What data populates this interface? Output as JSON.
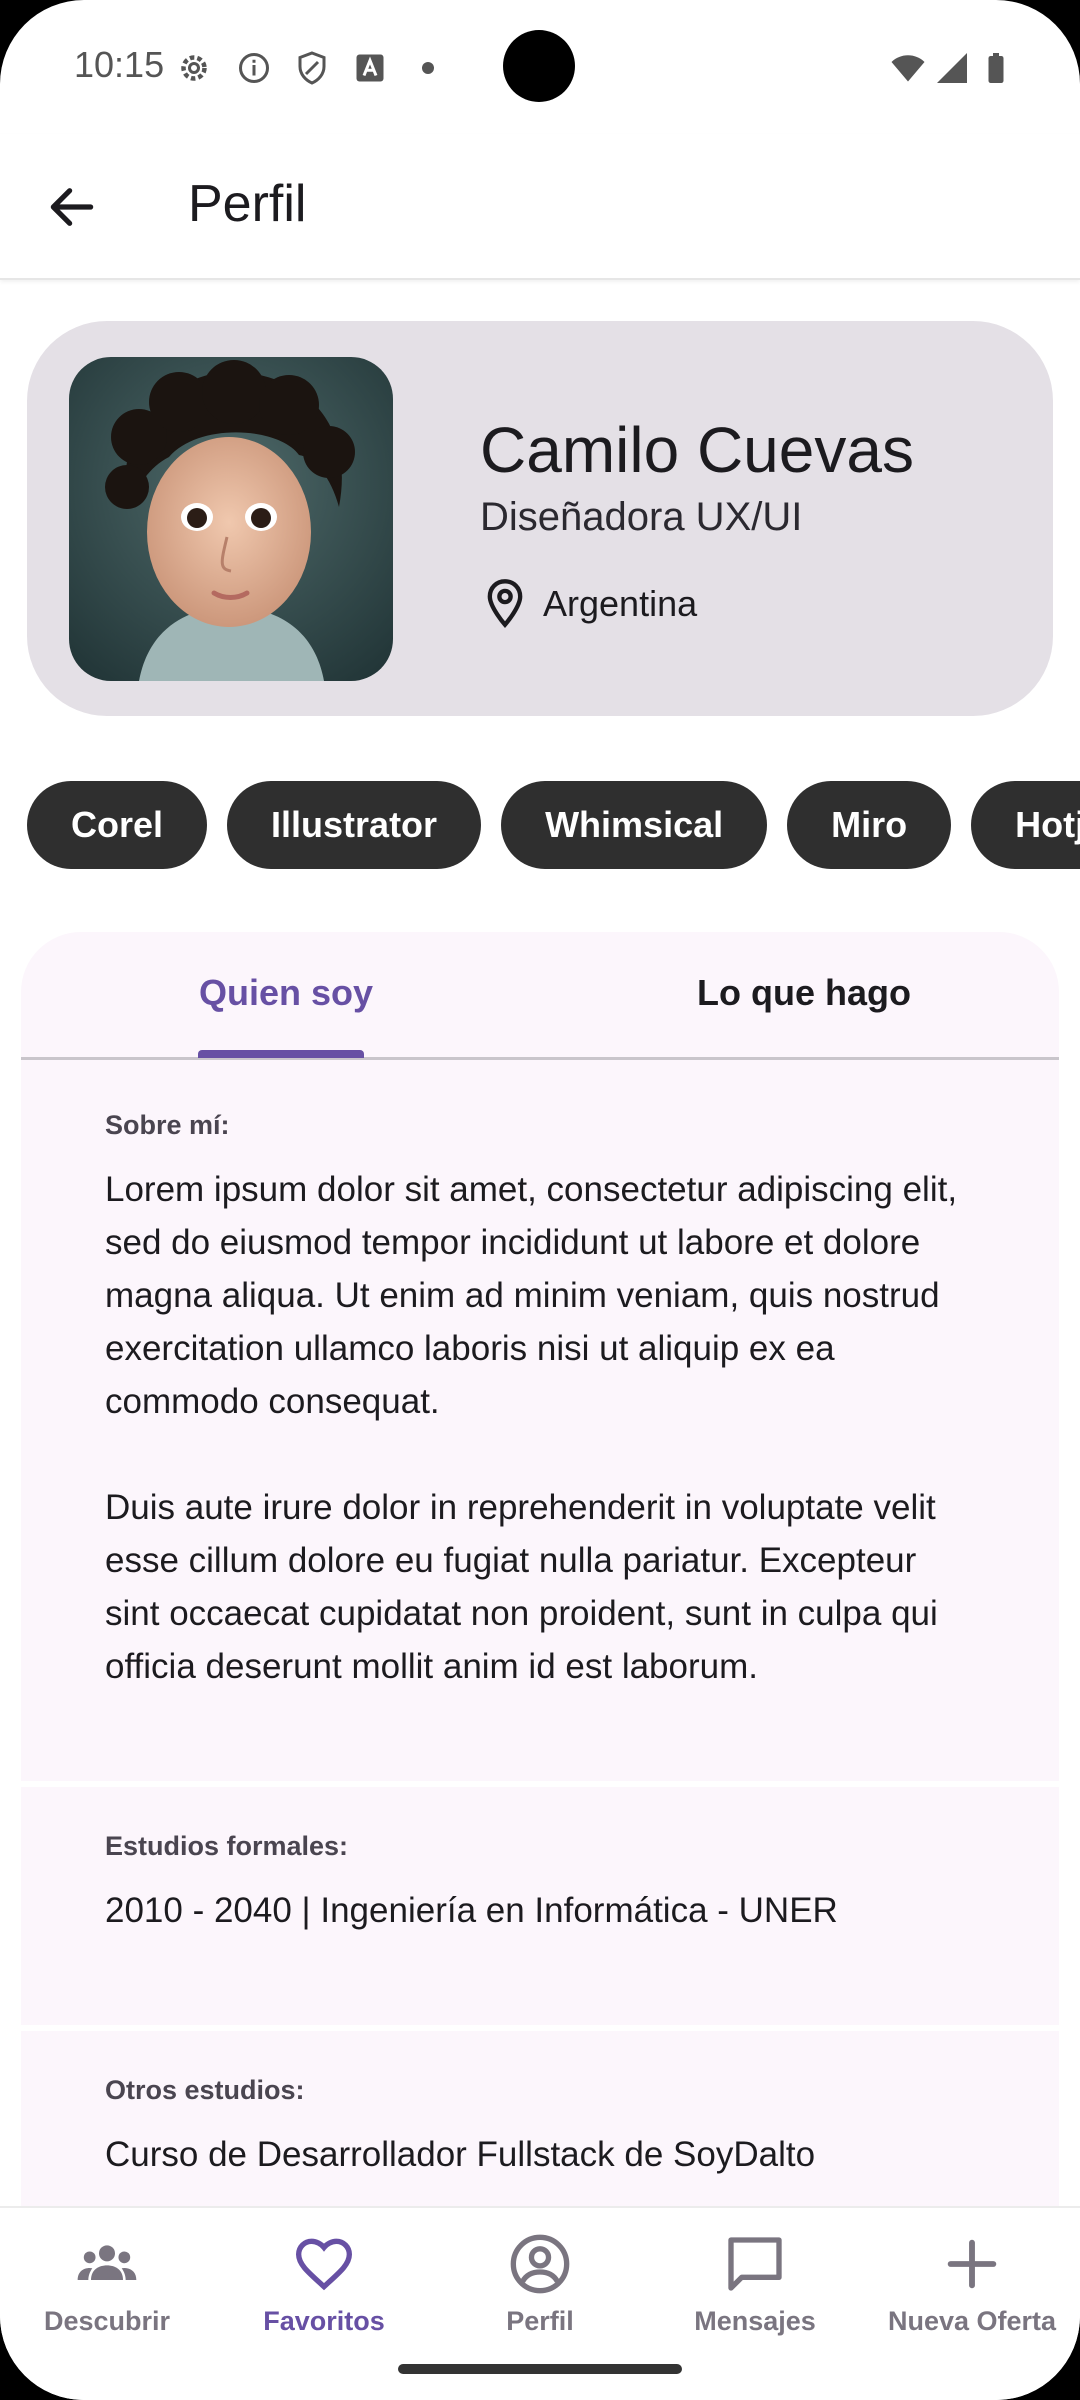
{
  "status_bar": {
    "time": "10:15"
  },
  "app_bar": {
    "title": "Perfil"
  },
  "profile": {
    "name": "Camilo Cuevas",
    "role": "Diseñadora UX/UI",
    "location": "Argentina"
  },
  "skills": [
    "Corel",
    "Illustrator",
    "Whimsical",
    "Miro",
    "Hotj"
  ],
  "tabs": [
    {
      "label": "Quien soy",
      "selected": true
    },
    {
      "label": "Lo que hago",
      "selected": false
    }
  ],
  "about": {
    "label": "Sobre mí:",
    "paragraph_1": "Lorem ipsum dolor sit amet, consectetur adipiscing elit, sed do eiusmod tempor incididunt ut labore et dolore magna aliqua. Ut enim ad minim veniam, quis nostrud exercitation ullamco laboris nisi ut aliquip ex ea commodo consequat.",
    "paragraph_2": "Duis aute irure dolor in reprehenderit in voluptate velit esse cillum dolore eu fugiat nulla pariatur. Excepteur sint occaecat cupidatat non proident, sunt in culpa qui officia deserunt mollit anim id est laborum."
  },
  "education": {
    "label": "Estudios formales:",
    "value": "2010 - 2040 | Ingeniería en Informática - UNER"
  },
  "other_studies": {
    "label": "Otros estudios:",
    "value": "Curso de Desarrollador Fullstack de SoyDalto"
  },
  "bottom_nav": [
    {
      "label": "Descubrir",
      "icon": "group-icon",
      "active": false
    },
    {
      "label": "Favoritos",
      "icon": "heart-icon",
      "active": true
    },
    {
      "label": "Perfil",
      "icon": "account-circle-icon",
      "active": false
    },
    {
      "label": "Mensajes",
      "icon": "chat-icon",
      "active": false
    },
    {
      "label": "Nueva Oferta",
      "icon": "plus-icon",
      "active": false
    }
  ],
  "colors": {
    "accent": "#6750a4",
    "card": "#e4e0e6",
    "chip": "#2f2f2f",
    "section_bg": "#fcf6fc"
  }
}
